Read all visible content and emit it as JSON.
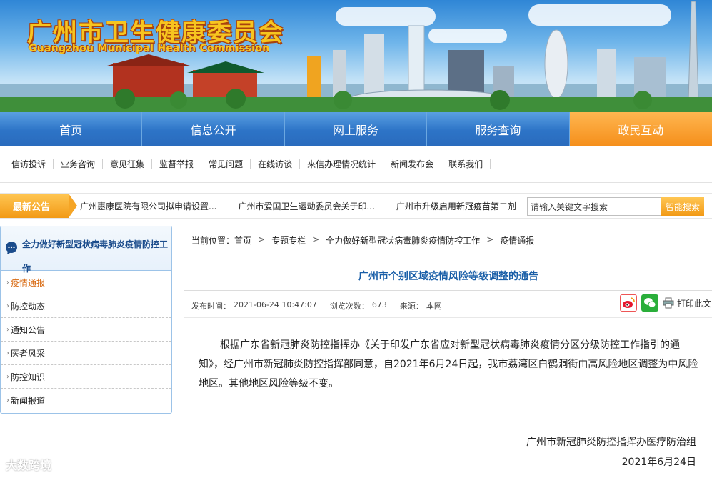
{
  "banner": {
    "title": "广州市卫生健康委员会",
    "subtitle": "Guangzhou Municipal Health Commission"
  },
  "main_nav": [
    {
      "label": "首页"
    },
    {
      "label": "信息公开"
    },
    {
      "label": "网上服务"
    },
    {
      "label": "服务查询"
    },
    {
      "label": "政民互动",
      "active": true
    }
  ],
  "sub_nav": [
    {
      "label": "信访投诉"
    },
    {
      "label": "业务咨询"
    },
    {
      "label": "意见征集"
    },
    {
      "label": "监督举报"
    },
    {
      "label": "常见问题"
    },
    {
      "label": "在线访谈"
    },
    {
      "label": "来信办理情况统计"
    },
    {
      "label": "新闻发布会"
    },
    {
      "label": "联系我们"
    }
  ],
  "notice": {
    "label": "最新公告",
    "items": [
      "广州惠康医院有限公司拟申请设置...",
      "广州市爱国卫生运动委员会关于印...",
      "广州市升级启用新冠疫苗第二剂"
    ]
  },
  "search": {
    "placeholder": "请输入关键文字搜索",
    "button": "智能搜索"
  },
  "sidebar": {
    "title": "全力做好新型冠状病毒肺炎疫情防控工作",
    "items": [
      {
        "label": "疫情通报",
        "active": true
      },
      {
        "label": "防控动态"
      },
      {
        "label": "通知公告"
      },
      {
        "label": "医者风采"
      },
      {
        "label": "防控知识"
      },
      {
        "label": "新闻报道"
      }
    ]
  },
  "breadcrumb": {
    "prefix": "当前位置：",
    "items": [
      "首页",
      "专题专栏",
      "全力做好新型冠状病毒肺炎疫情防控工作",
      "疫情通报"
    ],
    "separator": ">"
  },
  "article": {
    "title": "广州市个别区域疫情风险等级调整的通告",
    "publish_label": "发布时间：",
    "publish_time": "2021-06-24 10:47:07",
    "views_label": "浏览次数：",
    "views": "673",
    "source_label": "来源：",
    "source": "本网",
    "print_label": "打印此文",
    "body": "根据广东省新冠肺炎防控指挥办《关于印发广东省应对新型冠状病毒肺炎疫情分区分级防控工作指引的通知》，经广州市新冠肺炎防控指挥部同意，自2021年6月24日起，我市荔湾区白鹤洞街由高风险地区调整为中风险地区。其他地区风险等级不变。",
    "signature_org": "广州市新冠肺炎防控指挥办医疗防治组",
    "signature_date": "2021年6月24日"
  },
  "watermark": "大数跨境",
  "colors": {
    "nav_blue": "#2d74c7",
    "nav_active_orange": "#f58f1b",
    "title_blue": "#1a5fa8",
    "sidebar_active": "#d86a12"
  }
}
